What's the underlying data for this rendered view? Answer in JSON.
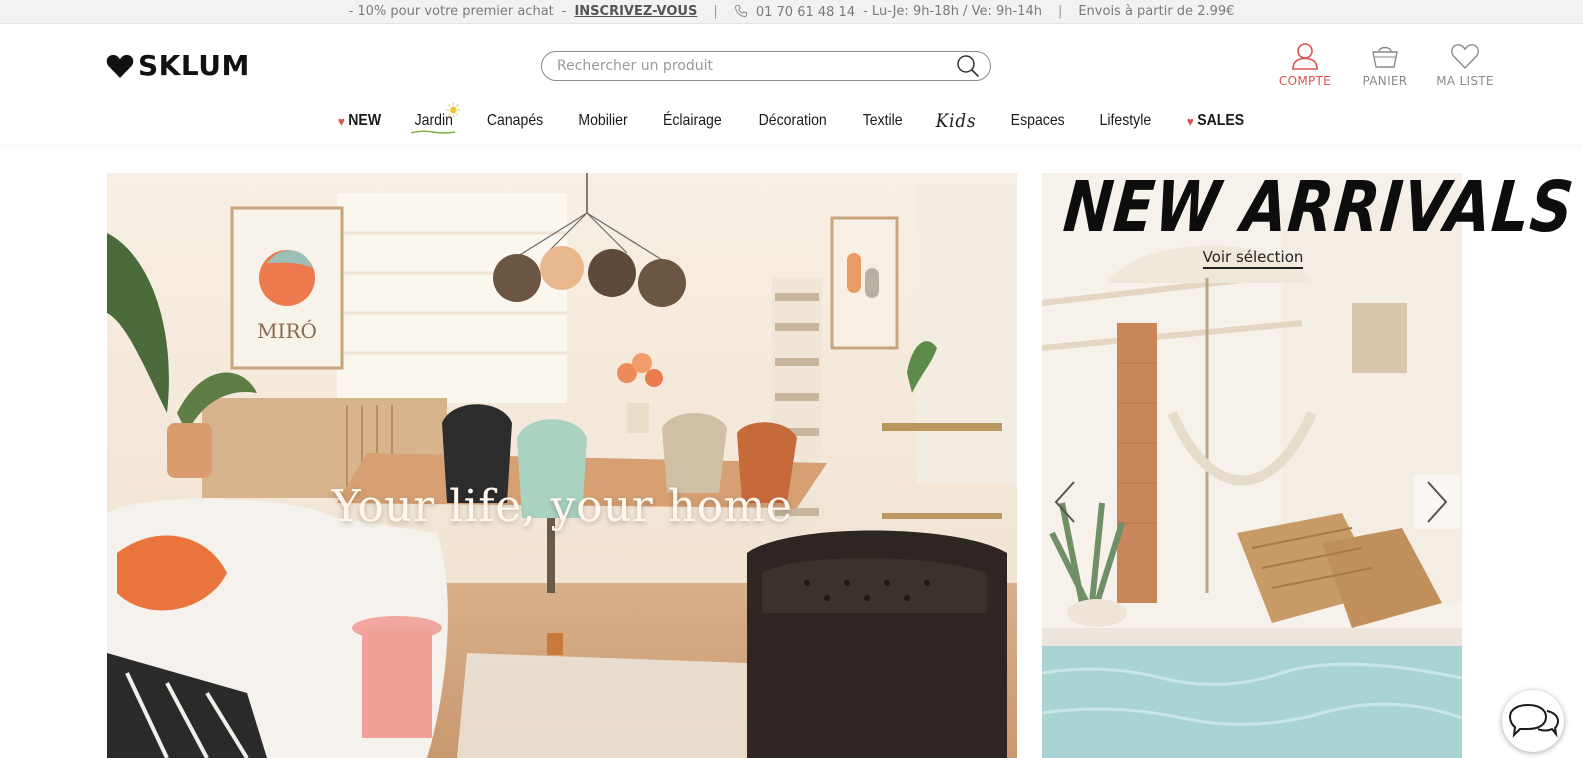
{
  "topbar": {
    "promo": "- 10% pour votre premier achat",
    "dash": "-",
    "signup_link": "INSCRIVEZ-VOUS",
    "separator": "|",
    "phone": "01 70 61 48 14",
    "hours": "-  Lu-Je: 9h-18h / Ve: 9h-14h",
    "shipping": "Envois à partir de 2.99€"
  },
  "header": {
    "logo_text": "SKLUM",
    "search_placeholder": "Rechercher un produit",
    "account": {
      "compte": "COMPTE",
      "panier": "PANIER",
      "ma_liste": "MA LISTE"
    }
  },
  "nav": {
    "items": [
      {
        "label": "NEW",
        "heart": "♥"
      },
      {
        "label": "Jardin"
      },
      {
        "label": "Canapés"
      },
      {
        "label": "Mobilier"
      },
      {
        "label": "Éclairage"
      },
      {
        "label": "Décoration"
      },
      {
        "label": "Textile"
      },
      {
        "label": "Kids"
      },
      {
        "label": "Espaces"
      },
      {
        "label": "Lifestyle"
      },
      {
        "label": "SALES",
        "heart": "♥"
      }
    ]
  },
  "hero_left": {
    "caption": "Your life, your home",
    "poster_text": "MIRÓ"
  },
  "hero_right": {
    "title": "NEW ARRIVALS",
    "cta": "Voir sélection"
  },
  "colors": {
    "accent_red": "#d9534f",
    "topbar_bg": "#f2f2f2",
    "text_dark": "#1a1a1a"
  },
  "icons": {
    "phone": "phone-icon",
    "search": "search-icon",
    "user": "user-icon",
    "basket": "basket-icon",
    "heart": "heart-icon",
    "chat": "chat-icon",
    "arrow_left": "chevron-left-icon",
    "arrow_right": "chevron-right-icon"
  }
}
